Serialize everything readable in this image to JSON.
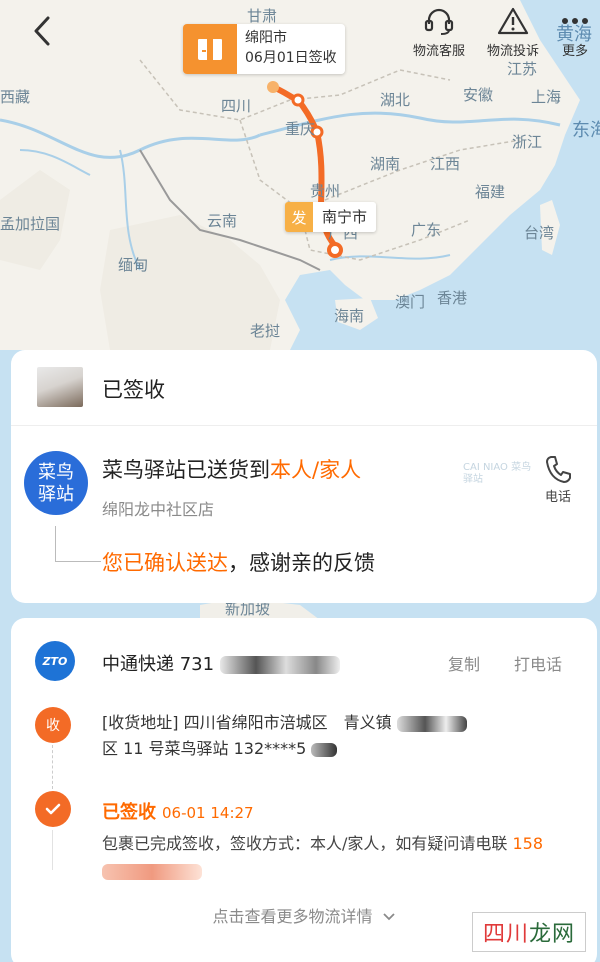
{
  "map": {
    "labels": {
      "gansu": "甘肃",
      "tibet": "西藏",
      "sichuan": "四川",
      "chongqing": "重庆",
      "hubei": "湖北",
      "anhui": "安徽",
      "jiangsu": "江苏",
      "shanghai": "上海",
      "zhejiang": "浙江",
      "hunan": "湖南",
      "jiangxi": "江西",
      "fujian": "福建",
      "guizhou": "贵州",
      "yunnan": "云南",
      "guangxi": "广西",
      "guangdong": "广东",
      "taiwan": "台湾",
      "bangladesh": "孟加拉国",
      "myanmar": "缅甸",
      "laos": "老挝",
      "hainan": "海南",
      "macau": "澳门",
      "hongkong": "香港",
      "east_china_sea": "东海",
      "yellow_sea": "黄海",
      "singapore": "新加坡"
    }
  },
  "header": {
    "actions": [
      {
        "label": "物流客服",
        "icon": "headset-icon"
      },
      {
        "label": "物流投诉",
        "icon": "warning-icon"
      },
      {
        "label": "更多",
        "icon": "more-icon"
      }
    ]
  },
  "destination_marker": {
    "city": "绵阳市",
    "status": "06月01日签收"
  },
  "origin_marker": {
    "tag": "发",
    "city": "南宁市"
  },
  "status_card": {
    "title": "已签收",
    "station_logo": "菜鸟驿站",
    "delivered_prefix": "菜鸟驿站已送货到",
    "delivered_highlight": "本人/家人",
    "station_name": "绵阳龙中社区店",
    "cainiao_watermark": "CAI NIAO 菜鸟驿站",
    "phone_label": "电话",
    "feedback_highlight": "您已确认送达",
    "feedback_rest": "，感谢亲的反馈"
  },
  "tracking_card": {
    "carrier_logo": "ZTO",
    "carrier": "中通快递",
    "tracking_visible": "731",
    "copy_label": "复制",
    "call_label": "打电话",
    "recv_node": "收",
    "address": "[收货地址] 四川省绵阳市涪城区　青义镇",
    "address_line2": "区 11 号菜鸟驿站 132****5",
    "done_title": "已签收",
    "done_time": "06-01 14:27",
    "done_desc": "包裹已完成签收，签收方式：本人/家人，如有疑问请电联",
    "done_phone_visible": "158",
    "more_label": "点击查看更多物流详情",
    "colors": {
      "accent": "#ff6a00",
      "node": "#f36b26",
      "logo": "#1e73d6"
    }
  },
  "watermark": {
    "part1": "四川",
    "part2": "龙网"
  }
}
